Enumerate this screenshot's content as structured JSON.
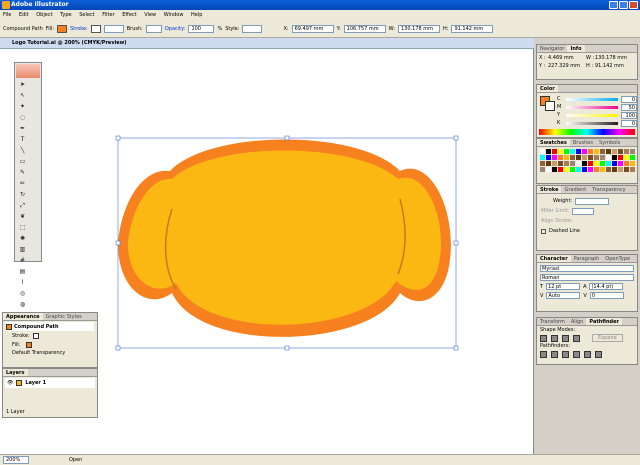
{
  "app": {
    "title": "Adobe Illustrator"
  },
  "menu": [
    "File",
    "Edit",
    "Object",
    "Type",
    "Select",
    "Filter",
    "Effect",
    "View",
    "Window",
    "Help"
  ],
  "control": {
    "selection": "Compound Path",
    "fill_label": "Fill:",
    "stroke_label": "Stroke:",
    "brush_label": "Brush:",
    "opacity_label": "Opacity:",
    "opacity_value": "100",
    "percent": "%",
    "style_label": "Style:",
    "x_label": "X:",
    "x_value": "69.497 mm",
    "y_label": "Y:",
    "y_value": "106.757 mm",
    "w_label": "W:",
    "w_value": "130.178 mm",
    "h_label": "H:",
    "h_value": "91.142 mm"
  },
  "document": {
    "tab": "Logo Tutorial.ai @ 200% (CMYK/Preview)"
  },
  "status": {
    "zoom": "200%",
    "state": "Open"
  },
  "info_panel": {
    "tabs": [
      "Navigator",
      "Info"
    ],
    "x_label": "X :",
    "x": "4.469 mm",
    "y_label": "Y :",
    "y": "227.329 mm",
    "w_label": "W :",
    "w": "130.178 mm",
    "h_label": "H :",
    "h": "91.142 mm"
  },
  "color_panel": {
    "tabs": [
      "Color"
    ],
    "channels": [
      {
        "label": "C",
        "value": "0",
        "color": "#00aeef"
      },
      {
        "label": "M",
        "value": "50",
        "color": "#ec008c"
      },
      {
        "label": "Y",
        "value": "100",
        "color": "#fff200"
      },
      {
        "label": "K",
        "value": "0",
        "color": "#231f20"
      }
    ]
  },
  "swatches_panel": {
    "tabs": [
      "Swatches",
      "Brushes",
      "Symbols"
    ]
  },
  "stroke_panel": {
    "tabs": [
      "Stroke",
      "Gradient",
      "Transparency"
    ],
    "weight_label": "Weight:",
    "miter_label": "Miter Limit:",
    "align_label": "Align Stroke:",
    "dashed_label": "Dashed Line"
  },
  "character_panel": {
    "tabs": [
      "Character",
      "Paragraph",
      "OpenType"
    ],
    "font": "Myriad",
    "style": "Roman",
    "size": "12 pt",
    "leading": "(14.4 pt)",
    "tracking": "Auto",
    "kerning": "0"
  },
  "pathfinder_panel": {
    "tabs": [
      "Transform",
      "Align",
      "Pathfinder"
    ],
    "shape_modes": "Shape Modes:",
    "expand": "Expand",
    "pathfinders": "Pathfinders:"
  },
  "appearance_panel": {
    "tabs": [
      "Appearance",
      "Graphic Styles"
    ],
    "title": "Compound Path",
    "stroke": "Stroke:",
    "fill": "Fill:",
    "transparency": "Default Transparency"
  },
  "layers_panel": {
    "tabs": [
      "Layers"
    ],
    "layer": "Layer 1",
    "count": "1 Layer"
  },
  "colors": {
    "fill": "#fbb813",
    "stroke": "#f7811f",
    "selection": "#4a6fd8"
  }
}
